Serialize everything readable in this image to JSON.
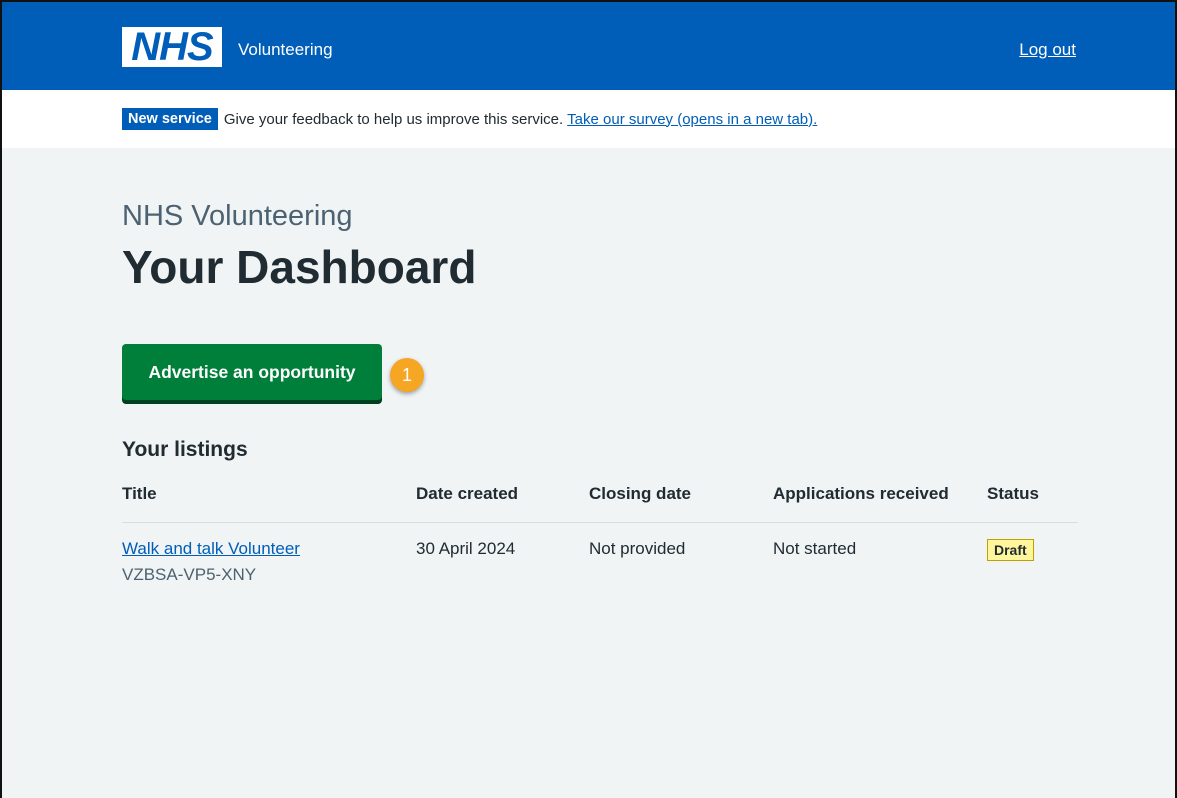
{
  "header": {
    "logo_text": "NHS",
    "service_name": "Volunteering",
    "logout_label": "Log out"
  },
  "banner": {
    "tag": "New service",
    "text": "Give your feedback to help us improve this service.",
    "link": "Take our survey (opens in a new tab)."
  },
  "main": {
    "caption": "NHS Volunteering",
    "title": "Your Dashboard",
    "button_label": "Advertise an opportunity",
    "callout_number": "1",
    "listings_heading": "Your listings"
  },
  "table": {
    "headers": [
      "Title",
      "Date created",
      "Closing date",
      "Applications received",
      "Status"
    ],
    "rows": [
      {
        "title": "Walk and talk Volunteer",
        "reference": "VZBSA-VP5-XNY",
        "date_created": "30 April 2024",
        "closing_date": "Not provided",
        "applications": "Not started",
        "status": "Draft"
      }
    ]
  },
  "colors": {
    "brand_blue": "#005eb8",
    "button_green": "#007f3b",
    "page_bg": "#f0f4f5",
    "callout_orange": "#f5a623",
    "draft_tag_bg": "#fff59d"
  }
}
